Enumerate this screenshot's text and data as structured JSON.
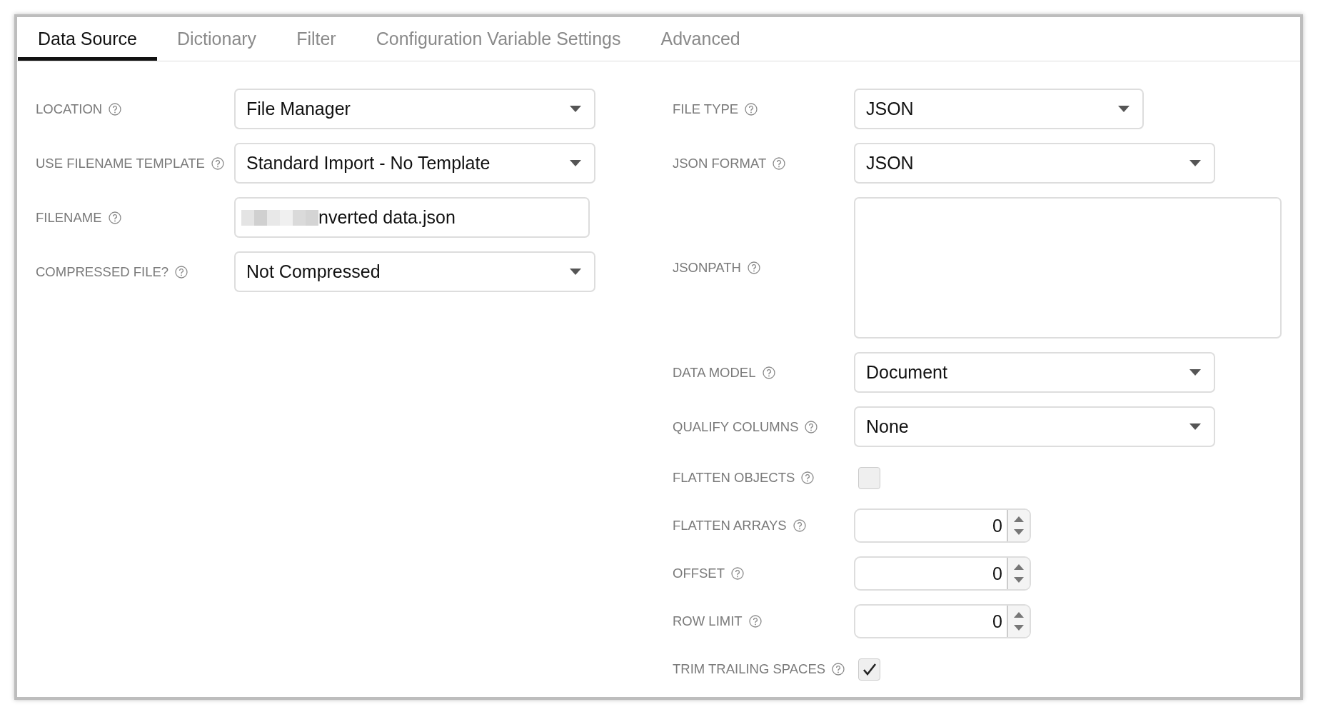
{
  "tabs": [
    {
      "label": "Data Source",
      "selected": true
    },
    {
      "label": "Dictionary",
      "selected": false
    },
    {
      "label": "Filter",
      "selected": false
    },
    {
      "label": "Configuration Variable Settings",
      "selected": false
    },
    {
      "label": "Advanced",
      "selected": false
    }
  ],
  "left_fields": [
    {
      "label": "LOCATION",
      "kind": "select",
      "value": "File Manager"
    },
    {
      "label": "USE FILENAME TEMPLATE",
      "kind": "select",
      "value": "Standard Import - No Template"
    },
    {
      "label": "FILENAME",
      "kind": "text",
      "value": "nverted data.json",
      "redacted": true
    },
    {
      "label": "COMPRESSED FILE?",
      "kind": "select",
      "value": "Not Compressed"
    }
  ],
  "right_fields": [
    {
      "label": "FILE TYPE",
      "kind": "select",
      "value": "JSON",
      "narrow": true
    },
    {
      "label": "JSON FORMAT",
      "kind": "select",
      "value": "JSON"
    },
    {
      "label": "JSONPATH",
      "kind": "textarea"
    },
    {
      "label": "DATA MODEL",
      "kind": "select",
      "value": "Document"
    },
    {
      "label": "QUALIFY COLUMNS",
      "kind": "select",
      "value": "None"
    },
    {
      "label": "FLATTEN OBJECTS",
      "kind": "checkbox",
      "checked": false
    },
    {
      "label": "FLATTEN ARRAYS",
      "kind": "number",
      "value": "0"
    },
    {
      "label": "OFFSET",
      "kind": "number",
      "value": "0"
    },
    {
      "label": "ROW LIMIT",
      "kind": "number",
      "value": "0"
    },
    {
      "label": "TRIM TRAILING SPACES",
      "kind": "checkbox",
      "checked": true
    }
  ]
}
